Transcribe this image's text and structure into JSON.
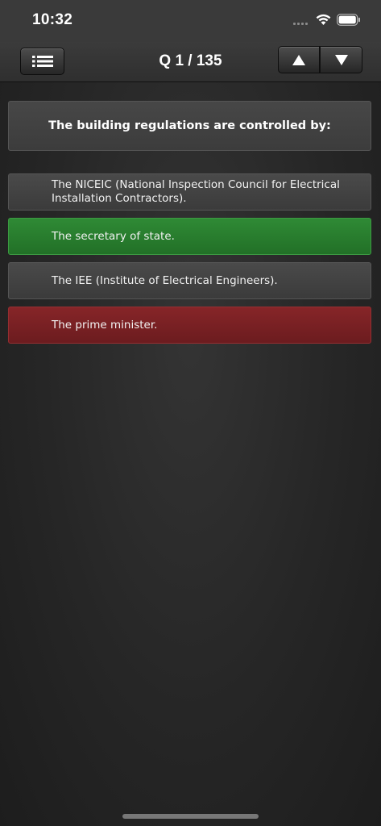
{
  "status_bar": {
    "time": "10:32"
  },
  "nav": {
    "title": "Q 1 / 135"
  },
  "question": {
    "text": "The building regulations are controlled by:"
  },
  "answers": [
    {
      "text": "The NICEIC (National Inspection Council for Electrical Installation Contractors).",
      "state": "neutral"
    },
    {
      "text": "The secretary of state.",
      "state": "correct"
    },
    {
      "text": "The IEE (Institute of Electrical Engineers).",
      "state": "neutral"
    },
    {
      "text": "The prime minister.",
      "state": "wrong"
    }
  ],
  "colors": {
    "correct": "#2a7f30",
    "wrong": "#7a2023",
    "neutral": "#424242"
  },
  "icons": {
    "menu": "list-icon",
    "up": "triangle-up-icon",
    "down": "triangle-down-icon"
  }
}
